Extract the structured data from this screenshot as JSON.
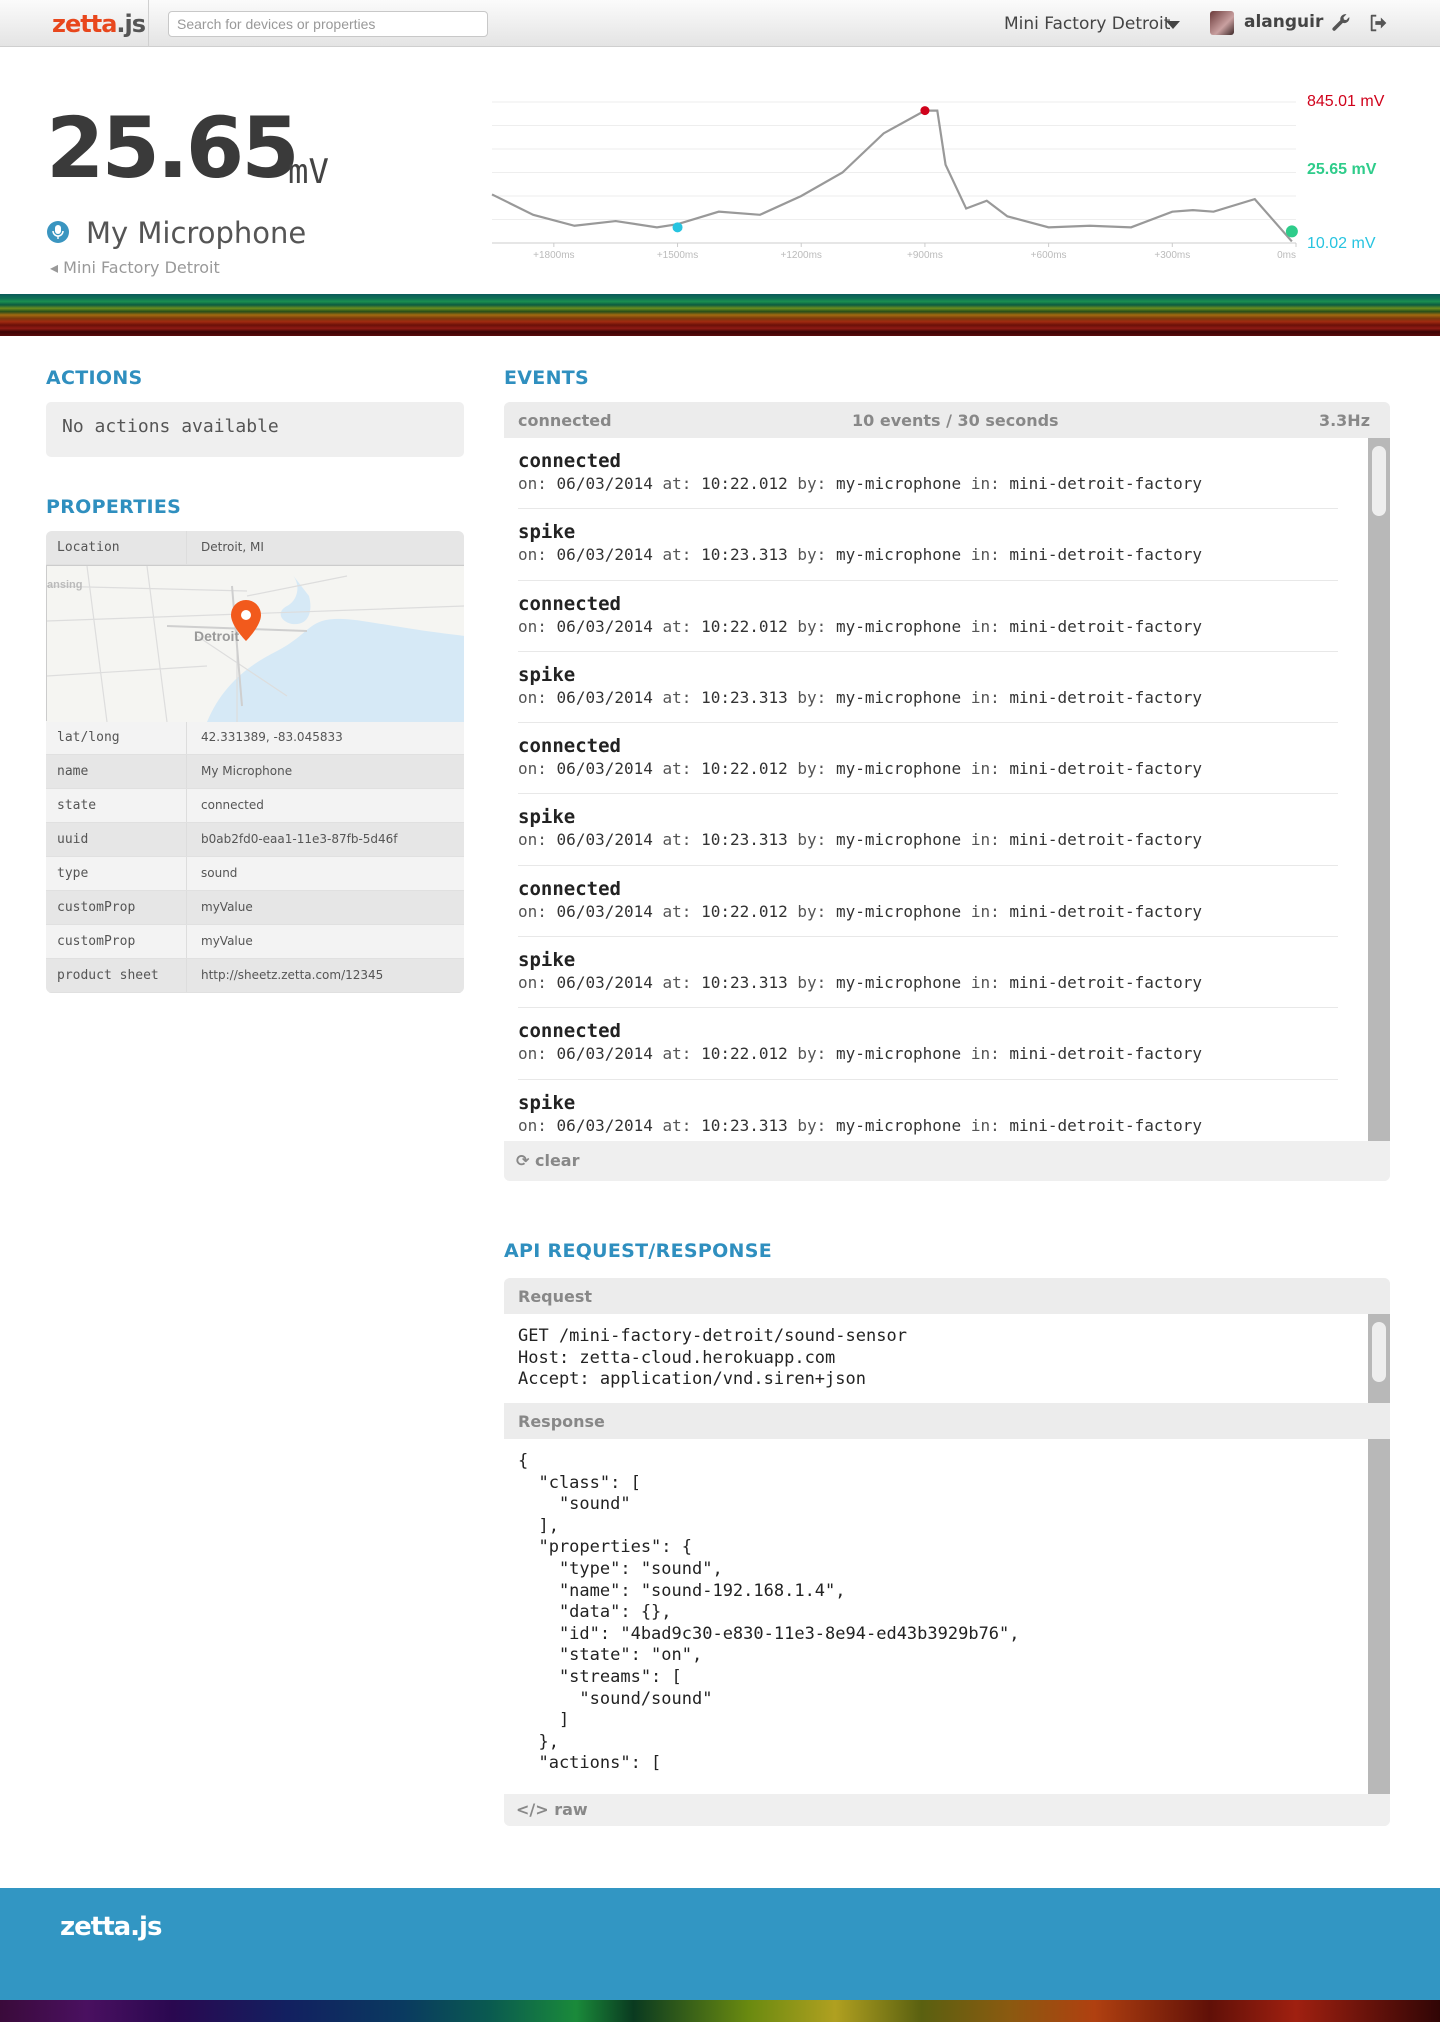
{
  "header": {
    "logo": "zetta",
    "logo_suffix": ".js",
    "search_placeholder": "Search for devices or properties",
    "server_name": "Mini Factory Detroit",
    "username": "alanguir"
  },
  "hero": {
    "value": "25.65",
    "unit": "mV",
    "device_name": "My Microphone",
    "back_link": "Mini Factory Detroit"
  },
  "chart_data": {
    "type": "line",
    "x": [
      -1950,
      -1850,
      -1750,
      -1650,
      -1550,
      -1500,
      -1400,
      -1300,
      -1200,
      -1100,
      -1000,
      -900,
      -870,
      -850,
      -800,
      -750,
      -700,
      -600,
      -500,
      -400,
      -300,
      -250,
      -200,
      -100,
      -10
    ],
    "values": [
      310,
      180,
      110,
      140,
      100,
      120,
      200,
      180,
      300,
      450,
      700,
      845.01,
      845,
      500,
      220,
      270,
      170,
      100,
      110,
      100,
      200,
      210,
      200,
      280,
      10.02
    ],
    "xticks": [
      "+1800ms",
      "+1500ms",
      "+1200ms",
      "+900ms",
      "+600ms",
      "+300ms",
      "0ms"
    ],
    "labels": {
      "max": "845.01 mV",
      "current": "25.65 mV",
      "min": "10.02 mV"
    },
    "colors": {
      "line": "#999999",
      "max": "#d0021b",
      "current": "#2ecc8a",
      "min": "#27c4e0"
    }
  },
  "actions": {
    "title": "ACTIONS",
    "empty_text": "No actions available"
  },
  "properties": {
    "title": "PROPERTIES",
    "location_label": "Location",
    "location_value": "Detroit, MI",
    "map_labels": {
      "city": "Detroit",
      "other": "ansing"
    },
    "rows": [
      {
        "key": "lat/long",
        "value": "42.331389, -83.045833"
      },
      {
        "key": "name",
        "value": "My Microphone"
      },
      {
        "key": "state",
        "value": "connected"
      },
      {
        "key": "uuid",
        "value": "b0ab2fd0-eaa1-11e3-87fb-5d46f"
      },
      {
        "key": "type",
        "value": "sound"
      },
      {
        "key": "customProp",
        "value": "myValue"
      },
      {
        "key": "customProp",
        "value": "myValue"
      },
      {
        "key": "product sheet",
        "value": "http://sheetz.zetta.com/12345"
      }
    ]
  },
  "events": {
    "title": "EVENTS",
    "state": "connected",
    "summary": "10 events / 30 seconds",
    "rate": "3.3Hz",
    "clear_label": "clear",
    "labels": {
      "on": "on:",
      "at": "at:",
      "by": "by:",
      "in": "in:"
    },
    "items": [
      {
        "type": "connected",
        "date": "06/03/2014",
        "time": "10:22.012",
        "by": "my-microphone",
        "in": "mini-detroit-factory"
      },
      {
        "type": "spike",
        "date": "06/03/2014",
        "time": "10:23.313",
        "by": "my-microphone",
        "in": "mini-detroit-factory"
      },
      {
        "type": "connected",
        "date": "06/03/2014",
        "time": "10:22.012",
        "by": "my-microphone",
        "in": "mini-detroit-factory"
      },
      {
        "type": "spike",
        "date": "06/03/2014",
        "time": "10:23.313",
        "by": "my-microphone",
        "in": "mini-detroit-factory"
      },
      {
        "type": "connected",
        "date": "06/03/2014",
        "time": "10:22.012",
        "by": "my-microphone",
        "in": "mini-detroit-factory"
      },
      {
        "type": "spike",
        "date": "06/03/2014",
        "time": "10:23.313",
        "by": "my-microphone",
        "in": "mini-detroit-factory"
      },
      {
        "type": "connected",
        "date": "06/03/2014",
        "time": "10:22.012",
        "by": "my-microphone",
        "in": "mini-detroit-factory"
      },
      {
        "type": "spike",
        "date": "06/03/2014",
        "time": "10:23.313",
        "by": "my-microphone",
        "in": "mini-detroit-factory"
      },
      {
        "type": "connected",
        "date": "06/03/2014",
        "time": "10:22.012",
        "by": "my-microphone",
        "in": "mini-detroit-factory"
      },
      {
        "type": "spike",
        "date": "06/03/2014",
        "time": "10:23.313",
        "by": "my-microphone",
        "in": "mini-detroit-factory"
      }
    ]
  },
  "api": {
    "title": "API REQUEST/RESPONSE",
    "request_label": "Request",
    "request_body": "GET /mini-factory-detroit/sound-sensor\nHost: zetta-cloud.herokuapp.com\nAccept: application/vnd.siren+json",
    "response_label": "Response",
    "response_body": "{\n  \"class\": [\n    \"sound\"\n  ],\n  \"properties\": {\n    \"type\": \"sound\",\n    \"name\": \"sound-192.168.1.4\",\n    \"data\": {},\n    \"id\": \"4bad9c30-e830-11e3-8e94-ed43b3929b76\",\n    \"state\": \"on\",\n    \"streams\": [\n      \"sound/sound\"\n    ]\n  },\n  \"actions\": [",
    "raw_label": "raw"
  },
  "footer": {
    "logo": "zetta.js"
  },
  "colors": {
    "accent": "#2f8fbf",
    "brand": "#e8471d",
    "footer": "#3296c3"
  }
}
